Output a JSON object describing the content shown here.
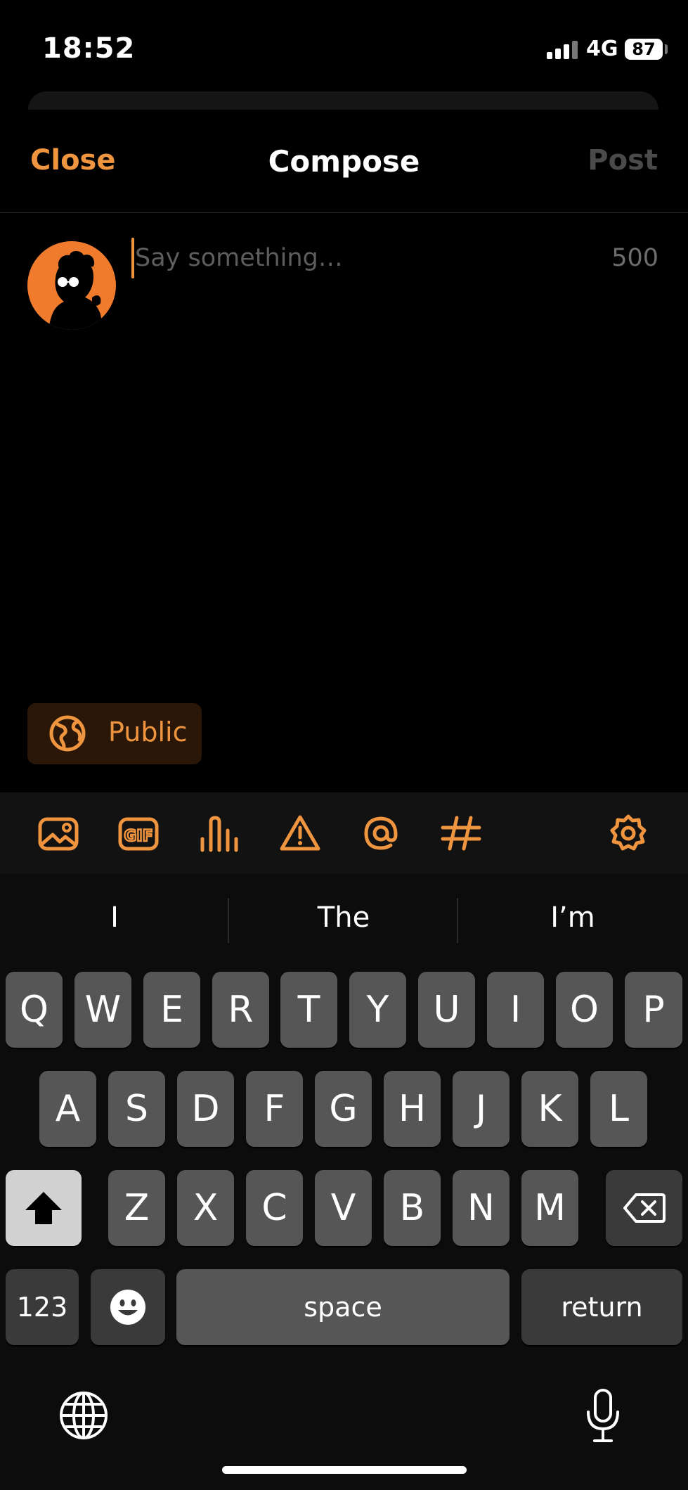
{
  "status_bar": {
    "time": "18:52",
    "network": "4G",
    "battery": "87"
  },
  "nav": {
    "close_label": "Close",
    "title": "Compose",
    "post_label": "Post"
  },
  "compose": {
    "placeholder": "Say something…",
    "char_count": "500",
    "visibility_label": "Public"
  },
  "toolbar": {
    "icons": [
      "image-icon",
      "gif-icon",
      "poll-icon",
      "warning-icon",
      "mention-icon",
      "hashtag-icon",
      "settings-icon"
    ]
  },
  "keyboard": {
    "predictions": [
      "I",
      "The",
      "I’m"
    ],
    "row1": [
      "Q",
      "W",
      "E",
      "R",
      "T",
      "Y",
      "U",
      "I",
      "O",
      "P"
    ],
    "row2": [
      "A",
      "S",
      "D",
      "F",
      "G",
      "H",
      "J",
      "K",
      "L"
    ],
    "row3": [
      "Z",
      "X",
      "C",
      "V",
      "B",
      "N",
      "M"
    ],
    "numbers_label": "123",
    "space_label": "space",
    "return_label": "return"
  },
  "colors": {
    "accent": "#f0953f",
    "background": "#000000",
    "key": "#565656",
    "key_dark": "#3a3a3a"
  }
}
